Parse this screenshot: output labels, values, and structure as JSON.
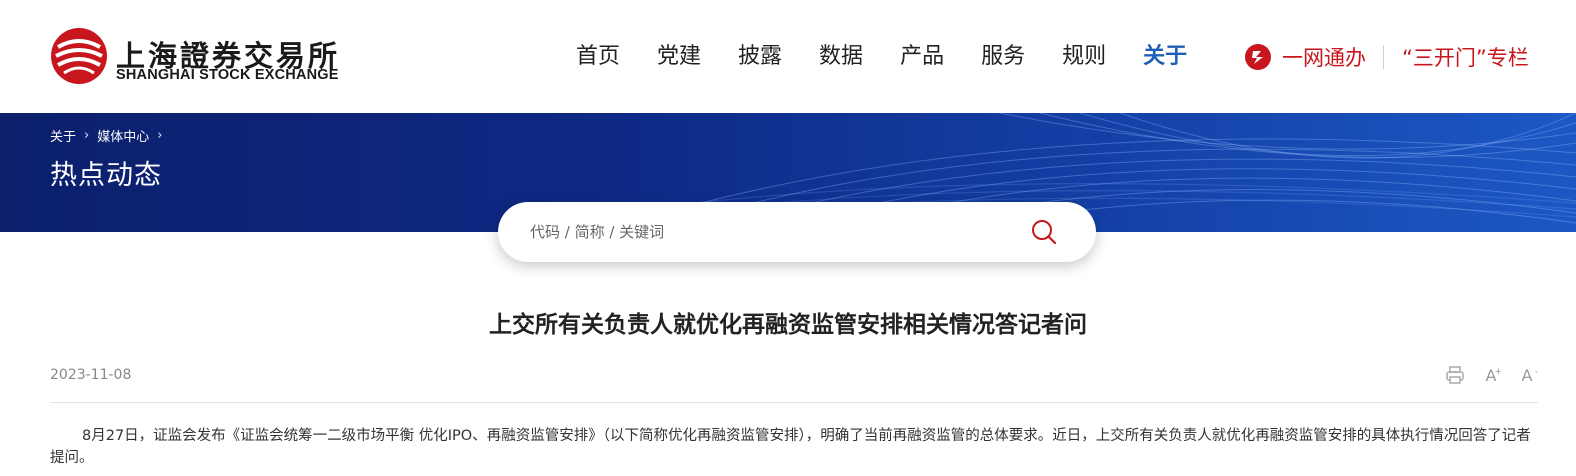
{
  "header": {
    "logo": {
      "name_cn": "上海證券交易所",
      "name_en": "SHANGHAI STOCK EXCHANGE"
    },
    "nav": [
      {
        "label": "首页"
      },
      {
        "label": "党建"
      },
      {
        "label": "披露"
      },
      {
        "label": "数据"
      },
      {
        "label": "产品"
      },
      {
        "label": "服务"
      },
      {
        "label": "规则"
      },
      {
        "label": "关于",
        "active": true
      }
    ],
    "one_stop": {
      "label": "一网通办",
      "icon": "one-stop-service-icon"
    },
    "column_link": {
      "label": "“三开门”专栏"
    }
  },
  "banner": {
    "breadcrumb": [
      "关于",
      "媒体中心"
    ],
    "title": "热点动态"
  },
  "search": {
    "placeholder": "代码 / 简称 / 关键词",
    "value": "",
    "icon": "search-icon"
  },
  "article": {
    "title": "上交所有关负责人就优化再融资监管安排相关情况答记者问",
    "date": "2023-11-08",
    "tools": [
      "print-icon",
      "font-increase-icon",
      "font-decrease-icon"
    ],
    "tool_labels": {
      "increase": "A",
      "increase_sup": "+",
      "decrease": "A",
      "decrease_sup": "-"
    },
    "body": "8月27日，证监会发布《证监会统筹一二级市场平衡 优化IPO、再融资监管安排》（以下简称优化再融资监管安排），明确了当前再融资监管的总体要求。近日，上交所有关负责人就优化再融资监管安排的具体执行情况回答了记者提问。"
  },
  "colors": {
    "brand_red": "#c8161d",
    "active_blue": "#1f5fb8",
    "banner_dark": "#0b1f6b",
    "banner_light": "#1c58c4"
  }
}
